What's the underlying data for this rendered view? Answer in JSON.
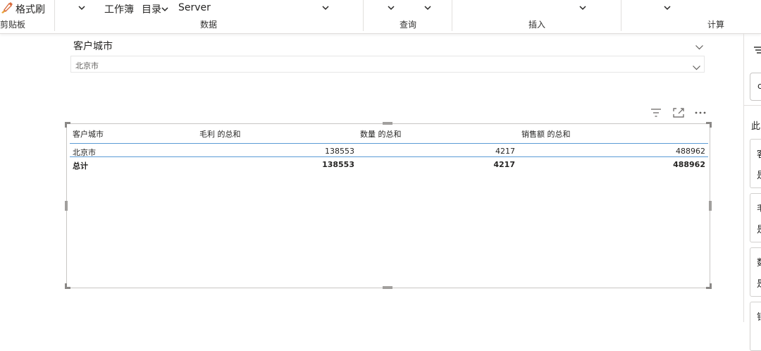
{
  "ribbon": {
    "clipboard": {
      "format_painter_label": "格式刷",
      "group_label": "剪贴板"
    },
    "data": {
      "workbook_label": "工作簿",
      "catalog_label": "目录",
      "server_label": "Server",
      "group_label": "数据"
    },
    "query": {
      "group_label": "查询"
    },
    "insert": {
      "group_label": "插入"
    },
    "calc": {
      "group_label": "计算"
    }
  },
  "slicer": {
    "title": "客户城市",
    "selected_value": "北京市"
  },
  "table": {
    "columns": [
      "客户城市",
      "毛利 的总和",
      "数量 的总和",
      "销售额 的总和"
    ],
    "rows": [
      {
        "city": "北京市",
        "gross_profit": "138553",
        "quantity": "4217",
        "sales": "488962"
      }
    ],
    "total": {
      "label": "总计",
      "gross_profit": "138553",
      "quantity": "4217",
      "sales": "488962"
    }
  },
  "right_pane": {
    "section_label": "此",
    "search_glyph": "c",
    "cards": [
      {
        "line1": "客",
        "line2": "是"
      },
      {
        "line1": "毛",
        "line2": "是"
      },
      {
        "line1": "数",
        "line2": "是"
      },
      {
        "line1": "销",
        "line2": ""
      }
    ]
  },
  "icons": {
    "format_painter": "paintbrush-icon",
    "filter": "filter-icon",
    "focus": "focus-mode-icon",
    "more": "more-options-icon",
    "accent": "#5b9bd5"
  }
}
